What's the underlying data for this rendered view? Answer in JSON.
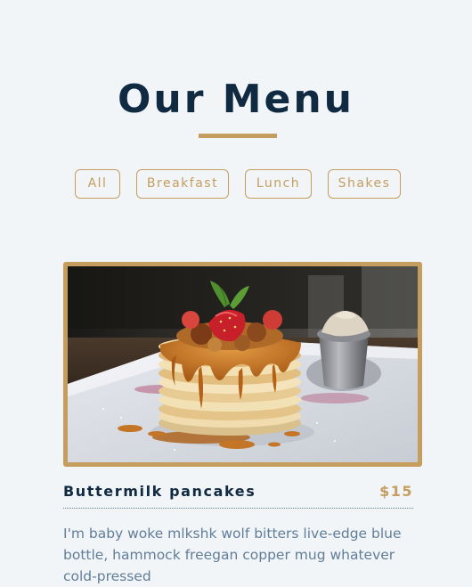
{
  "page": {
    "title": "Our Menu"
  },
  "filters": [
    {
      "label": "All"
    },
    {
      "label": "Breakfast"
    },
    {
      "label": "Lunch"
    },
    {
      "label": "Shakes"
    }
  ],
  "colors": {
    "accent": "#c59d5f",
    "heading": "#102a42",
    "body_text": "#617d98",
    "background": "#f1f5f8"
  },
  "menu_item": {
    "image_subject": "pancakes",
    "name": "Buttermilk pancakes",
    "price": "$15",
    "description": "I'm baby woke mlkshk wolf bitters live-edge blue bottle, hammock freegan copper mug whatever cold-pressed"
  }
}
